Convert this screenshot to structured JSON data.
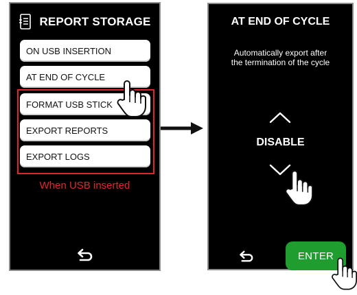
{
  "left_screen": {
    "title": "REPORT STORAGE",
    "title_icon": "document-list-icon",
    "menu_items": [
      {
        "label": "ON USB INSERTION"
      },
      {
        "label": "AT END OF CYCLE"
      },
      {
        "label": "FORMAT USB STICK"
      },
      {
        "label": "EXPORT REPORTS"
      },
      {
        "label": "EXPORT LOGS"
      }
    ],
    "usb_note": "When USB inserted",
    "back_icon": "return-arrow-icon"
  },
  "right_screen": {
    "title": "AT END OF CYCLE",
    "description_line1": "Automatically export after",
    "description_line2": "the termination of the cycle",
    "up_icon": "chevron-up-icon",
    "value": "DISABLE",
    "down_icon": "chevron-down-icon",
    "back_icon": "return-arrow-icon",
    "enter_label": "ENTER"
  },
  "colors": {
    "highlight_red": "#e0262d",
    "enter_green": "#1f9d2e",
    "screen_bg": "#000000"
  }
}
